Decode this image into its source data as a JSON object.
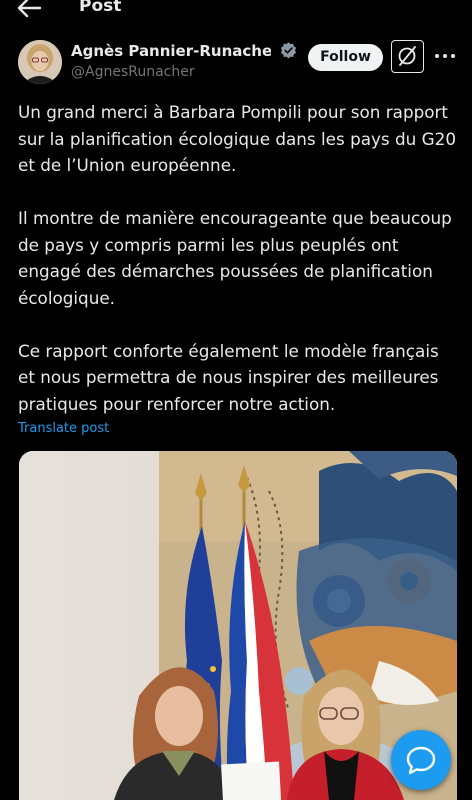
{
  "header": {
    "title": "Post",
    "back_icon": "arrow-left-icon"
  },
  "author": {
    "name": "Agnès Pannier-Runache...",
    "handle": "@AgnesRunacher",
    "verified": true,
    "verified_color": "#8b98a5"
  },
  "actions": {
    "follow_label": "Follow",
    "grok_icon": "grok-icon",
    "more_icon": "more-dots-icon"
  },
  "tweet": {
    "paragraphs": [
      [
        "Un grand merci à Barbara Pompili pour son rapport",
        "sur la planification écologique dans les pays du G20",
        "et de l’Union européenne."
      ],
      [
        "Il montre de manière encourageante que beaucoup",
        "de pays y compris parmi les plus peuplés ont",
        "engagé des démarches poussées de planification",
        "écologique."
      ],
      [
        "Ce rapport conforte également le modèle français",
        "et nous permettra de nous inspirer des meilleures",
        "pratiques pour renforcer notre action."
      ]
    ],
    "translate_label": "Translate post"
  },
  "media": {
    "type": "photo"
  },
  "fab": {
    "icon": "compose-reply-icon"
  },
  "colors": {
    "background": "#000000",
    "text": "#e7e9ea",
    "secondary": "#71767b",
    "accent": "#1d9bf0"
  }
}
